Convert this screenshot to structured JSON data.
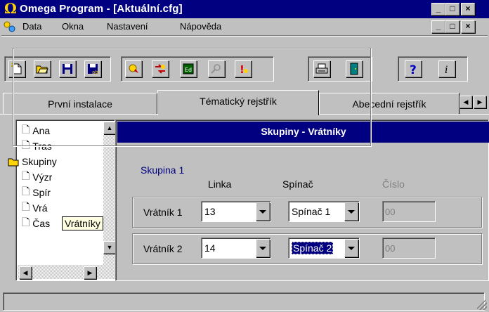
{
  "window": {
    "icon": "Ω",
    "title": "Omega Program - [Aktuální.cfg]",
    "buttons": [
      "_",
      "□",
      "×"
    ]
  },
  "menubar": {
    "items": [
      "Data",
      "Okna",
      "Nastavení",
      "Nápověda"
    ],
    "doc_buttons": [
      "_",
      "□",
      "×"
    ]
  },
  "toolbar": {
    "icons": [
      "new-document-icon",
      "open-folder-icon",
      "save-icon",
      "save-as-icon",
      "connect-icon",
      "transfer-icon",
      "module-icon",
      "search-icon",
      "alert-icon",
      "print-icon",
      "exit-door-icon",
      "help-icon",
      "info-icon"
    ]
  },
  "tabs": [
    {
      "label": "První instalace",
      "active": false
    },
    {
      "label": "Tématický rejstřík",
      "active": true
    },
    {
      "label": "Abecední rejstřík",
      "active": false
    }
  ],
  "tree": {
    "items": [
      {
        "label": "Ana",
        "type": "document"
      },
      {
        "label": "Tras",
        "type": "document"
      },
      {
        "label": "Skupiny",
        "type": "folder-open"
      },
      {
        "label": "Výzr",
        "type": "document"
      },
      {
        "label": "Spír",
        "type": "document"
      },
      {
        "label": "Vrá",
        "type": "document"
      },
      {
        "label": "Čas",
        "type": "document"
      }
    ],
    "tooltip": "Vrátníky"
  },
  "panel": {
    "title": "Skupiny - Vrátníky",
    "group_title": "Skupina 1",
    "columns": [
      "Linka",
      "Spínač",
      "Číslo"
    ],
    "rows": [
      {
        "label": "Vrátník 1",
        "linka": "13",
        "spinac": "Spínač 1",
        "cislo": "00"
      },
      {
        "label": "Vrátník 2",
        "linka": "14",
        "spinac": "Spínač 2",
        "cislo": "00"
      }
    ]
  },
  "colors": {
    "titlebar": "#000080",
    "face": "#c0c0c0",
    "tooltip": "#ffffe1"
  }
}
